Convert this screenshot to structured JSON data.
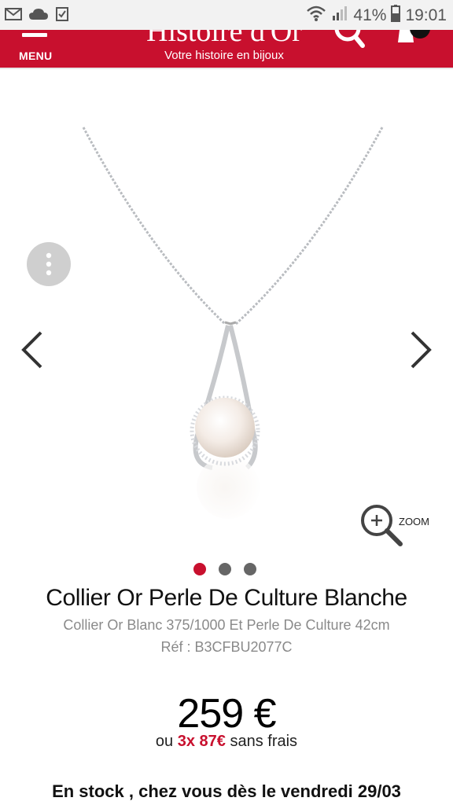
{
  "status_bar": {
    "battery": "41%",
    "time": "19:01"
  },
  "header": {
    "menu_label": "MENU",
    "logo_name": "Histoire d'Or",
    "logo_tagline": "Votre histoire en bijoux"
  },
  "gallery": {
    "zoom_label": "ZOOM",
    "dots_count": 3,
    "active_dot": 0
  },
  "product": {
    "title": "Collier Or Perle De Culture Blanche",
    "subtitle": "Collier Or Blanc 375/1000 Et Perle De Culture 42cm",
    "reference": "Réf : B3CFBU2077C",
    "price": "259 €",
    "installments_prefix": "ou ",
    "installments_amount": "3x 87€",
    "installments_suffix": " sans frais",
    "stock": "En stock , chez vous dès le vendredi 29/03"
  },
  "colors": {
    "brand": "#c8102e"
  }
}
